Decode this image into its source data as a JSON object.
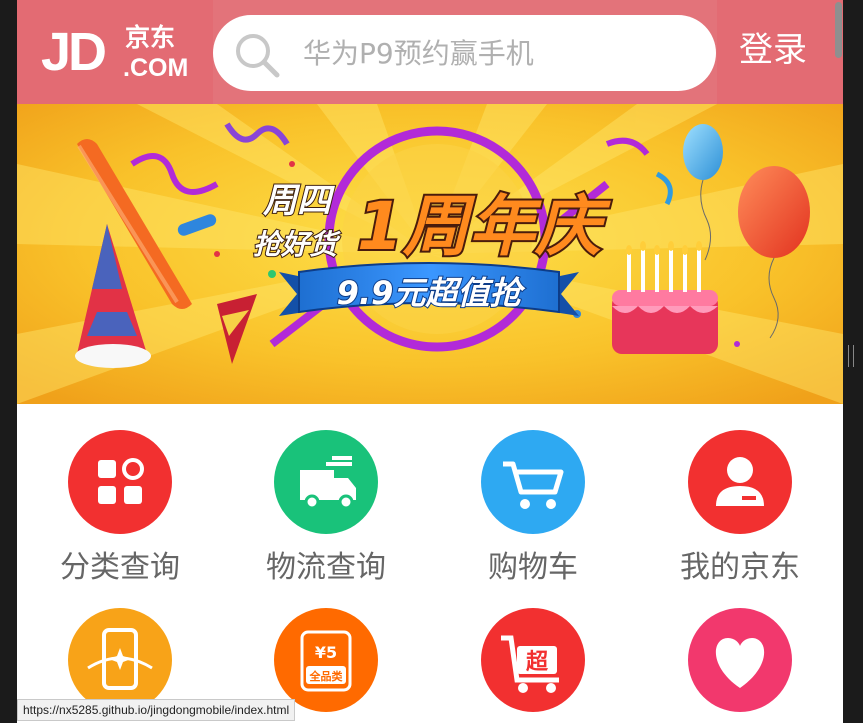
{
  "header": {
    "logo_jd": "JD",
    "logo_cn": "京东",
    "logo_com": ".COM",
    "search_placeholder": "华为P9预约赢手机",
    "login_label": "登录"
  },
  "banner": {
    "line1": "周四",
    "line2": "抢好货",
    "headline": "1周年庆",
    "ribbon": "9.9元超值抢",
    "slide_count": 8,
    "active_slide": 7
  },
  "nav": [
    {
      "label": "分类查询",
      "icon": "category-grid-icon",
      "color": "#f23030"
    },
    {
      "label": "物流查询",
      "icon": "delivery-truck-icon",
      "color": "#19c27a"
    },
    {
      "label": "购物车",
      "icon": "shopping-cart-icon",
      "color": "#2ea9f2"
    },
    {
      "label": "我的京东",
      "icon": "user-profile-icon",
      "color": "#f23030"
    },
    {
      "label": "",
      "icon": "phone-recharge-icon",
      "color": "#f8a318"
    },
    {
      "label": "",
      "icon": "coupon-icon",
      "color": "#ff6a00",
      "coupon_value": "¥5",
      "coupon_text": "全品类"
    },
    {
      "label": "",
      "icon": "supermarket-cart-icon",
      "color": "#f23030",
      "badge": "超"
    },
    {
      "label": "",
      "icon": "heart-icon",
      "color": "#f2386d"
    }
  ],
  "status_url": "https://nx5285.github.io/jingdongmobile/index.html"
}
